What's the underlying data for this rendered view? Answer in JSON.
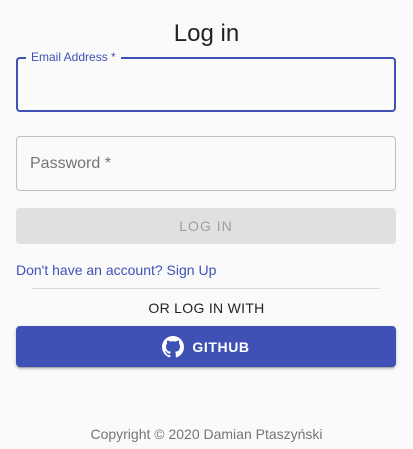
{
  "page": {
    "title": "Log in"
  },
  "form": {
    "email": {
      "label": "Email Address *",
      "value": ""
    },
    "password": {
      "label": "Password *",
      "value": ""
    },
    "login_button": "LOG IN",
    "signup_link": "Don't have an account? Sign Up"
  },
  "social": {
    "heading": "OR LOG IN WITH",
    "github_button": "GITHUB",
    "github_icon": "github-icon"
  },
  "footer": {
    "copyright": "Copyright © 2020 Damian Ptaszyński"
  },
  "colors": {
    "primary": "#3f51b5",
    "background": "#fafafa",
    "disabled_button": "#e0e0e0"
  }
}
